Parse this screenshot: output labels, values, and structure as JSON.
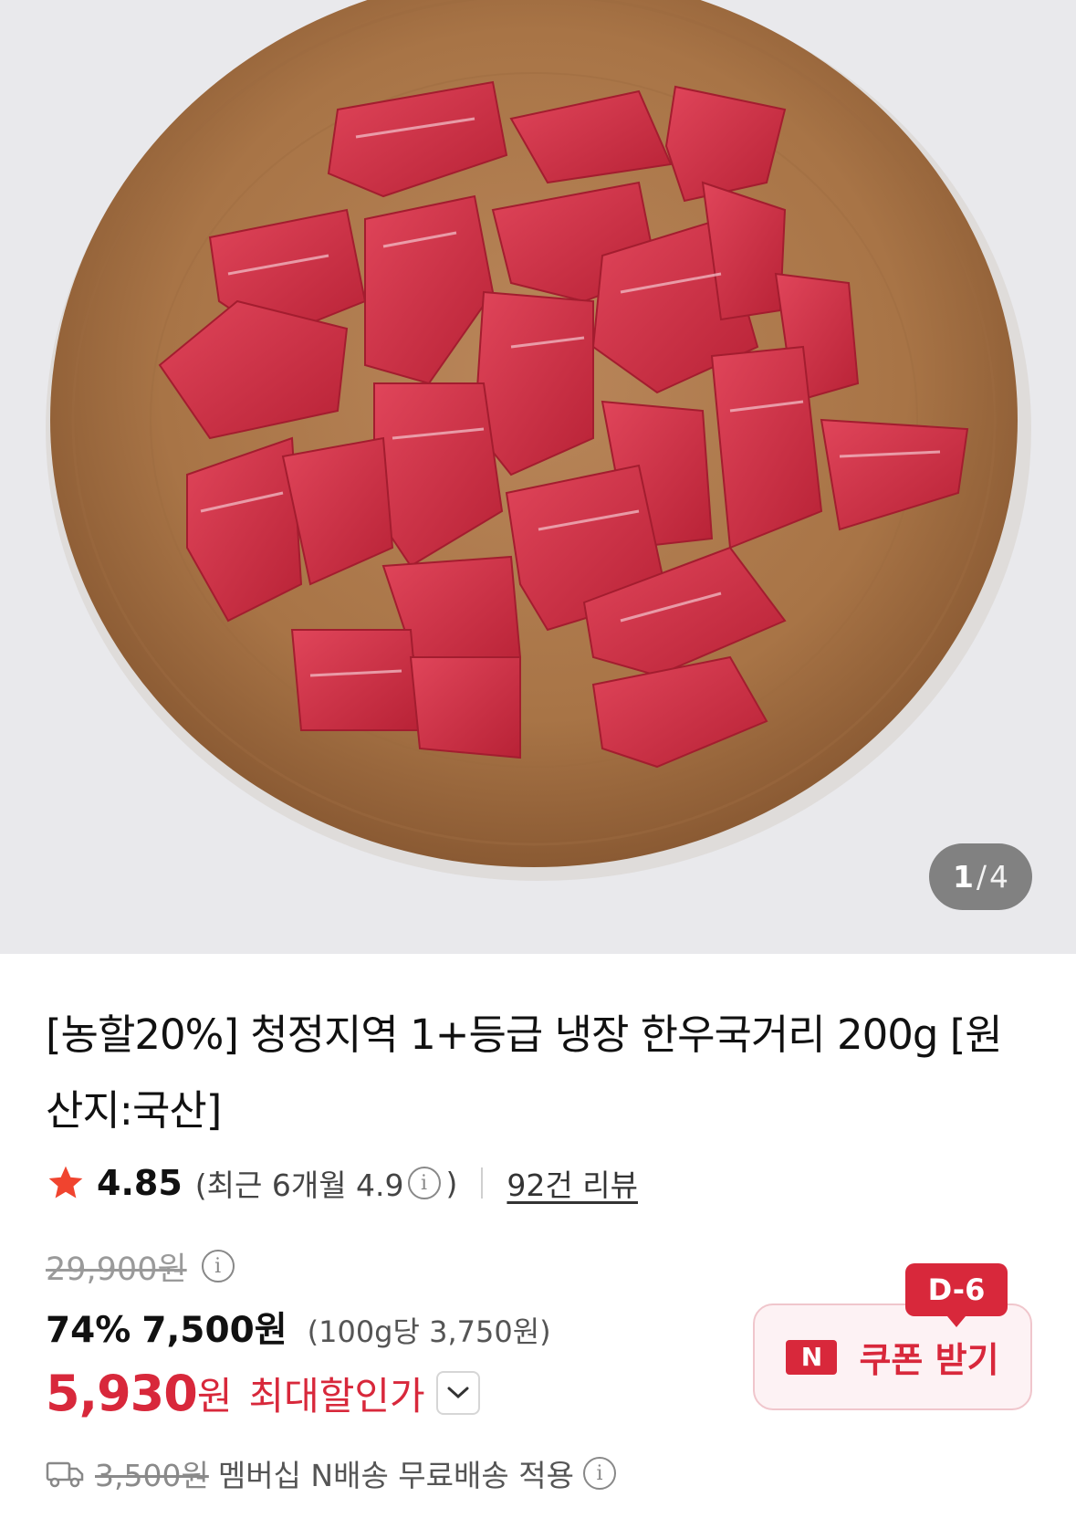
{
  "gallery": {
    "current": "1",
    "separator": "/",
    "total": "4",
    "image_alt": "한우국거리 상품 이미지"
  },
  "product": {
    "title": "[농할20%] 청정지역 1+등급 냉장 한우국거리 200g [원산지:국산]"
  },
  "rating": {
    "score": "4.85",
    "recent_label": "(최근 6개월 4.9",
    "recent_close": ")",
    "reviews": "92건 리뷰"
  },
  "price": {
    "original": "29,900원",
    "discount_pct": "74%",
    "discount_price": "7,500원",
    "unit_price": "(100g당 3,750원)",
    "final_amount": "5,930",
    "final_won": "원",
    "final_label": "최대할인가"
  },
  "shipping": {
    "fee": "3,500원",
    "message": "멤버십 N배송 무료배송 적용"
  },
  "coupon": {
    "badge": "D-6",
    "logo": "N",
    "label": "쿠폰 받기"
  },
  "colors": {
    "accent": "#d8283b",
    "star": "#f0442f"
  },
  "icons": [
    "star-icon",
    "info-icon",
    "chevron-down-icon",
    "truck-icon",
    "naver-n-icon"
  ]
}
